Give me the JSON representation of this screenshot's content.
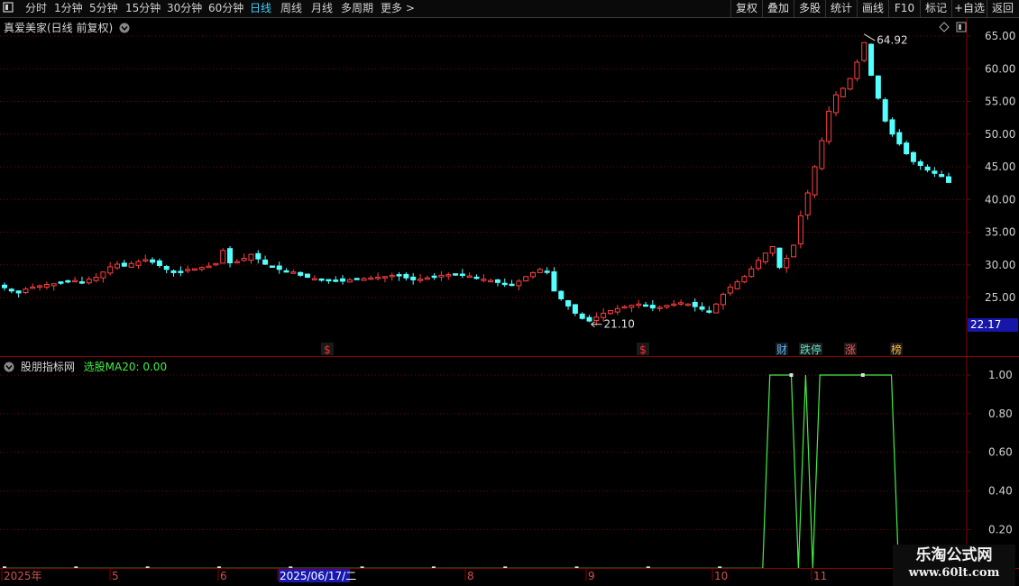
{
  "toolbar": {
    "left_icon": "panel-toggle-icon",
    "periods": [
      "分时",
      "1分钟",
      "5分钟",
      "15分钟",
      "30分钟",
      "60分钟",
      "日线",
      "周线",
      "月线",
      "多周期",
      "更多"
    ],
    "active_period": "日线",
    "more_arrow": ">",
    "buttons": [
      "复权",
      "叠加",
      "多股",
      "统计",
      "画线",
      "F10",
      "标记",
      "+自选",
      "返回"
    ]
  },
  "main_chart": {
    "title": "真爱美家(日线 前复权)",
    "price_axis": [
      "65.00",
      "60.00",
      "55.00",
      "50.00",
      "45.00",
      "40.00",
      "35.00",
      "30.00",
      "25.00"
    ],
    "last_price": "22.17",
    "high_label": "64.92",
    "low_label": "21.10",
    "markers": [
      {
        "text": "$",
        "color": "#ff3030"
      },
      {
        "text": "$",
        "color": "#ff3030"
      },
      {
        "text": "财",
        "color": "#5ab4ff"
      },
      {
        "text": "跌停",
        "color": "#5fe0c0"
      },
      {
        "text": "涨",
        "color": "#ff5050"
      },
      {
        "text": "榜",
        "color": "#ffb040"
      }
    ]
  },
  "indicator": {
    "name": "股朋指标网",
    "line_label": "选股MA20: 0.00",
    "axis": [
      "1.00",
      "0.80",
      "0.60",
      "0.40",
      "0.20"
    ]
  },
  "date_axis": {
    "labels": [
      "2025年",
      "5",
      "6",
      "2025/06/17/二",
      "8",
      "9",
      "10",
      "11"
    ]
  },
  "watermark": {
    "line1": "乐淘公式网",
    "line2": "www.60lt.com"
  },
  "colors": {
    "up": "#ff4040",
    "down": "#54ffff",
    "grid": "#7a0000",
    "indicator_line": "#44ee44",
    "accent": "#3fd0ff"
  },
  "chart_data": {
    "type": "candlestick",
    "series": [
      {
        "name": "选股MA20"
      }
    ],
    "ylim": [
      20,
      66
    ],
    "price_path": [
      26.5,
      26,
      25.7,
      26.3,
      26.6,
      26.8,
      27.0,
      27.1,
      27.3,
      27.5,
      27.6,
      27.4,
      27.8,
      28.1,
      28.9,
      29.7,
      30.1,
      29.8,
      30.2,
      30.5,
      30.8,
      30.4,
      29.9,
      29.3,
      28.8,
      29.0,
      29.3,
      29.4,
      29.6,
      29.8,
      30.2,
      32.2,
      30.3,
      30.5,
      31.0,
      31.6,
      30.9,
      30.1,
      29.8,
      29.3,
      29.0,
      28.9,
      28.4,
      28.1,
      27.9,
      27.8,
      27.7,
      27.6,
      27.5,
      27.7,
      27.8,
      27.9,
      28.0,
      28.1,
      28.2,
      28.4,
      28.3,
      28.0,
      27.7,
      27.8,
      28.0,
      28.2,
      28.4,
      28.5,
      28.6,
      28.5,
      28.3,
      28.0,
      27.8,
      27.6,
      27.3,
      27.1,
      26.9,
      27.5,
      28.2,
      28.8,
      29.3,
      28.9,
      26.0,
      24.8,
      23.7,
      22.6,
      21.8,
      21.4,
      22.0,
      22.6,
      23.0,
      23.3,
      23.6,
      23.8,
      24.0,
      23.7,
      23.4,
      23.5,
      23.8,
      24.0,
      24.2,
      24.0,
      23.6,
      23.2,
      22.8,
      24.0,
      25.5,
      26.6,
      27.4,
      28.2,
      29.4,
      30.7,
      31.8,
      32.8,
      29.6,
      31.0,
      33.0,
      37.5,
      41.0,
      45.0,
      49.0,
      53.5,
      56.0,
      57.0,
      58.5,
      61.0,
      64.0,
      59.0,
      55.5,
      52.0,
      50.0,
      48.5,
      47.0,
      45.8,
      45.2,
      44.5,
      44.0,
      43.5,
      42.6
    ],
    "indicator_values": [
      0,
      0,
      0,
      0,
      0,
      0,
      0,
      0,
      0,
      0,
      0,
      0,
      0,
      0,
      0,
      0,
      0,
      0,
      0,
      0,
      0,
      0,
      0,
      0,
      0,
      0,
      0,
      0,
      0,
      0,
      0,
      0,
      0,
      0,
      0,
      0,
      0,
      0,
      0,
      0,
      0,
      0,
      0,
      0,
      0,
      0,
      0,
      0,
      0,
      0,
      0,
      0,
      0,
      0,
      0,
      0,
      0,
      0,
      0,
      0,
      0,
      0,
      0,
      0,
      0,
      0,
      0,
      0,
      0,
      0,
      0,
      0,
      0,
      0,
      0,
      0,
      0,
      0,
      0,
      0,
      0,
      0,
      0,
      0,
      0,
      0,
      0,
      0,
      0,
      0,
      0,
      0,
      0,
      0,
      0,
      0,
      0,
      0,
      0,
      0,
      0,
      0,
      0,
      0,
      0,
      0,
      0,
      1,
      1,
      1,
      1,
      0,
      1,
      0,
      1,
      1,
      1,
      1,
      1,
      1,
      1,
      1,
      1,
      1,
      1,
      0,
      0,
      0,
      0,
      0,
      0,
      0,
      0
    ]
  }
}
